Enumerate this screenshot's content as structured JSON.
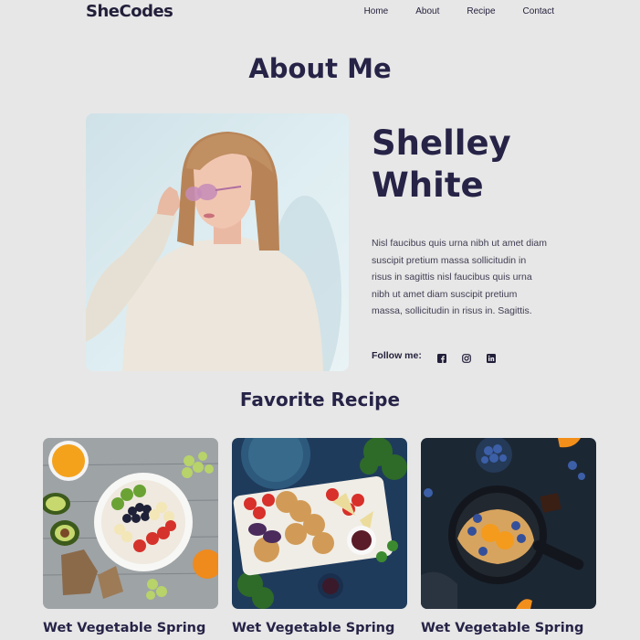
{
  "nav": {
    "logo": "SheCodes",
    "links": [
      "Home",
      "About",
      "Recipe",
      "Contact"
    ]
  },
  "about": {
    "title": "About Me",
    "name_first": "Shelley",
    "name_last": "White",
    "bio": "Nisl faucibus quis urna nibh ut amet diam suscipit pretium massa sollicitudin in risus in sagittis nisl faucibus quis urna nibh ut amet diam suscipit pretium massa, sollicitudin in risus in. Sagittis.",
    "follow_label": "Follow me:",
    "social_icons": [
      "facebook-icon",
      "instagram-icon",
      "linkedin-icon"
    ]
  },
  "recipes": {
    "title": "Favorite Recipe",
    "cards": [
      {
        "title": "Wet Vegetable Spring"
      },
      {
        "title": "Wet Vegetable Spring"
      },
      {
        "title": "Wet Vegetable Spring"
      }
    ]
  },
  "colors": {
    "background": "#e7e7e7",
    "text": "#221f3a"
  }
}
